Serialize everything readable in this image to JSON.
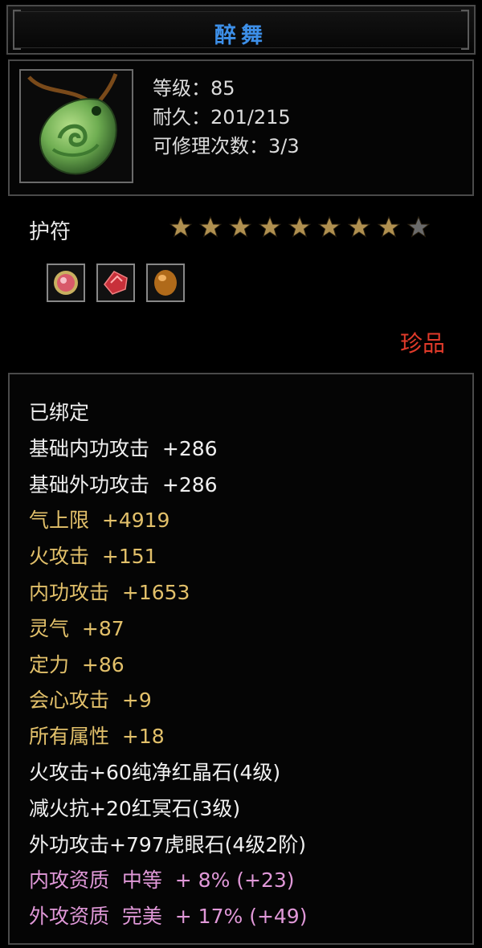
{
  "item": {
    "name": "醉舞",
    "level_line": "等级：85",
    "durability_line": "耐久：201/215",
    "repair_line": "可修理次数：3/3",
    "type": "护符",
    "rarity": "珍品",
    "stars": {
      "filled": 8,
      "total": 9,
      "filled_color": "#b09050",
      "empty_color": "#6a6a6a"
    },
    "gems": [
      {
        "name": "pink-gem-icon",
        "color": "#d85a6a"
      },
      {
        "name": "red-crystal-icon",
        "color": "#c8303a"
      },
      {
        "name": "amber-stone-icon",
        "color": "#b06a1a"
      }
    ],
    "icon": "jade-pendant-icon"
  },
  "attributes": [
    {
      "text": "已绑定",
      "color": "white"
    },
    {
      "text": "基础内功攻击  +286",
      "color": "white"
    },
    {
      "text": "基础外功攻击  +286",
      "color": "white"
    },
    {
      "text": "气上限  +4919",
      "color": "yellow"
    },
    {
      "text": "火攻击  +151",
      "color": "yellow"
    },
    {
      "text": "内功攻击  +1653",
      "color": "yellow"
    },
    {
      "text": "灵气  +87",
      "color": "yellow"
    },
    {
      "text": "定力  +86",
      "color": "yellow"
    },
    {
      "text": "会心攻击  +9",
      "color": "yellow"
    },
    {
      "text": "所有属性  +18",
      "color": "yellow"
    },
    {
      "text": "火攻击+60纯净红晶石(4级)",
      "color": "white"
    },
    {
      "text": "减火抗+20红冥石(3级)",
      "color": "white"
    },
    {
      "text": "外功攻击+797虎眼石(4级2阶)",
      "color": "white"
    },
    {
      "text": "内攻资质  中等  + 8% (+23)",
      "color": "pink"
    },
    {
      "text": "外攻资质  完美  + 17% (+49)",
      "color": "pink"
    }
  ],
  "colors": {
    "title": "#3d8fe8",
    "rarity": "#e03a2a",
    "white": "#f0f0f0",
    "yellow": "#e2c06a",
    "pink": "#e098d8"
  }
}
